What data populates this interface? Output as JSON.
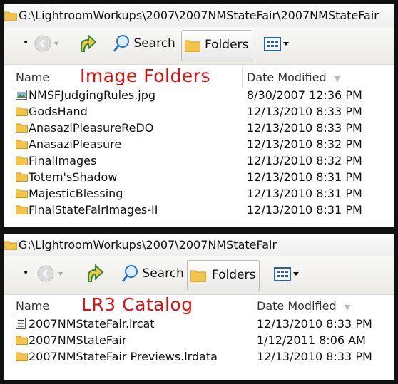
{
  "top_window": {
    "address_path": "G:\\LightroomWorkups\\2007\\2007NMStateFair\\2007NMStateFair",
    "toolbar": {
      "search_label": "Search",
      "folders_label": "Folders"
    },
    "columns": {
      "name": "Name",
      "date_modified": "Date Modified"
    },
    "overlay_label": "Image Folders",
    "rows": [
      {
        "name": "NMSFJudgingRules.jpg",
        "date": "8/30/2007 12:36 PM",
        "icon": "jpg-file-icon"
      },
      {
        "name": "GodsHand",
        "date": "12/13/2010 8:33 PM",
        "icon": "folder-icon"
      },
      {
        "name": "AnasaziPleasureReDO",
        "date": "12/13/2010 8:33 PM",
        "icon": "folder-icon"
      },
      {
        "name": "AnasaziPleasure",
        "date": "12/13/2010 8:32 PM",
        "icon": "folder-icon"
      },
      {
        "name": "FinalImages",
        "date": "12/13/2010 8:32 PM",
        "icon": "folder-icon"
      },
      {
        "name": "Totem'sShadow",
        "date": "12/13/2010 8:31 PM",
        "icon": "folder-icon"
      },
      {
        "name": "MajesticBlessing",
        "date": "12/13/2010 8:31 PM",
        "icon": "folder-icon"
      },
      {
        "name": "FinalStateFairImages-II",
        "date": "12/13/2010 8:31 PM",
        "icon": "folder-icon"
      }
    ]
  },
  "bottom_window": {
    "address_path": "G:\\LightroomWorkups\\2007\\2007NMStateFair",
    "toolbar": {
      "search_label": "Search",
      "folders_label": "Folders"
    },
    "columns": {
      "name": "Name",
      "date_modified": "Date Modified"
    },
    "overlay_label": "LR3 Catalog",
    "rows": [
      {
        "name": "2007NMStateFair.lrcat",
        "date": "12/13/2010 8:33 PM",
        "icon": "catalog-file-icon"
      },
      {
        "name": "2007NMStateFair",
        "date": "1/12/2011 8:06 AM",
        "icon": "folder-icon"
      },
      {
        "name": "2007NMStateFair Previews.lrdata",
        "date": "12/13/2010 8:33 PM",
        "icon": "folder-icon"
      }
    ]
  },
  "colors": {
    "overlay_red": "#e01010",
    "folder_yellow": "#f2c54a"
  }
}
